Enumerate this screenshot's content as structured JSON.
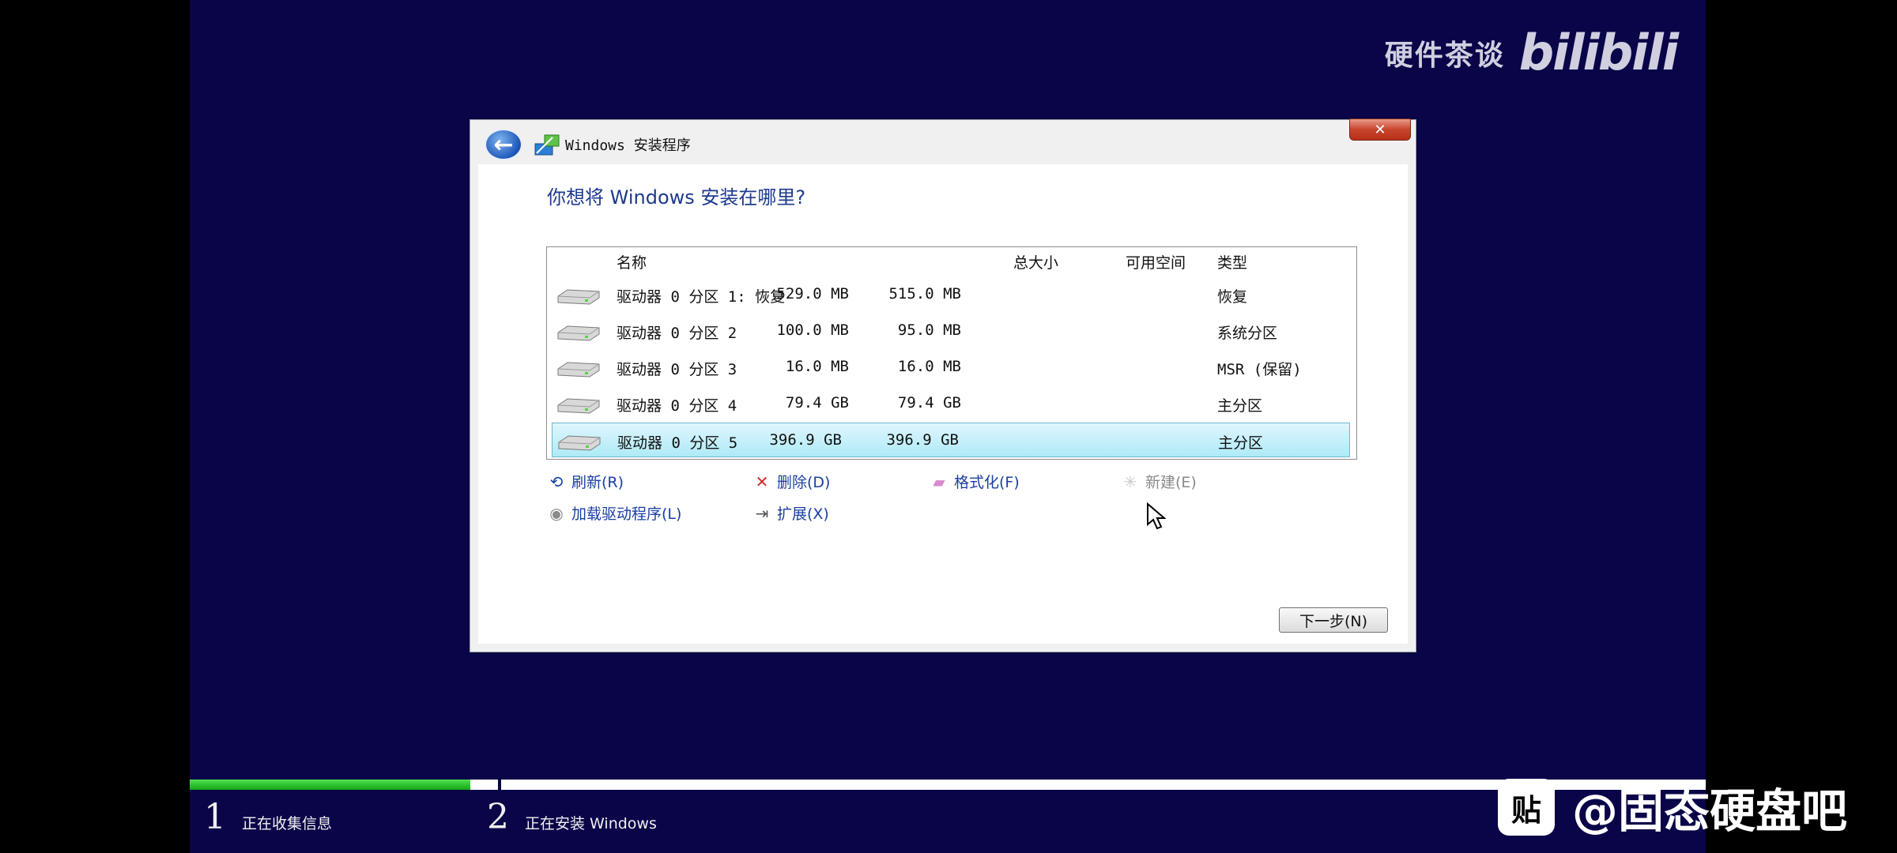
{
  "watermarks": {
    "top_right_text": "硬件茶谈",
    "top_right_logo": "bilibili",
    "bottom_right_logo": "贴",
    "bottom_right_text": "@固态硬盘吧"
  },
  "dialog": {
    "title": "Windows 安装程序",
    "close_label": "✕",
    "heading": "你想将 Windows 安装在哪里?",
    "columns": {
      "name": "名称",
      "total": "总大小",
      "free": "可用空间",
      "type": "类型"
    },
    "partitions": [
      {
        "name": "驱动器 0 分区 1: 恢复",
        "total": "529.0 MB",
        "free": "515.0 MB",
        "type": "恢复",
        "selected": false
      },
      {
        "name": "驱动器 0 分区 2",
        "total": "100.0 MB",
        "free": "95.0 MB",
        "type": "系统分区",
        "selected": false
      },
      {
        "name": "驱动器 0 分区 3",
        "total": "16.0 MB",
        "free": "16.0 MB",
        "type": "MSR (保留)",
        "selected": false
      },
      {
        "name": "驱动器 0 分区 4",
        "total": "79.4 GB",
        "free": "79.4 GB",
        "type": "主分区",
        "selected": false
      },
      {
        "name": "驱动器 0 分区 5",
        "total": "396.9 GB",
        "free": "396.9 GB",
        "type": "主分区",
        "selected": true
      }
    ],
    "actions": {
      "refresh": "刷新(R)",
      "delete": "删除(D)",
      "format": "格式化(F)",
      "new": "新建(E)",
      "load_driver": "加载驱动程序(L)",
      "extend": "扩展(X)"
    },
    "next_button": "下一步(N)"
  },
  "progress": {
    "fraction": 0.185,
    "steps": [
      {
        "number": "1",
        "label": "正在收集信息"
      },
      {
        "number": "2",
        "label": "正在安装 Windows"
      }
    ]
  },
  "colors": {
    "background": "#0a0548",
    "heading": "#1d3a8e",
    "link": "#1a3fa3",
    "selected_row": "#aeeaf7",
    "progress_fill": "#16a516"
  }
}
